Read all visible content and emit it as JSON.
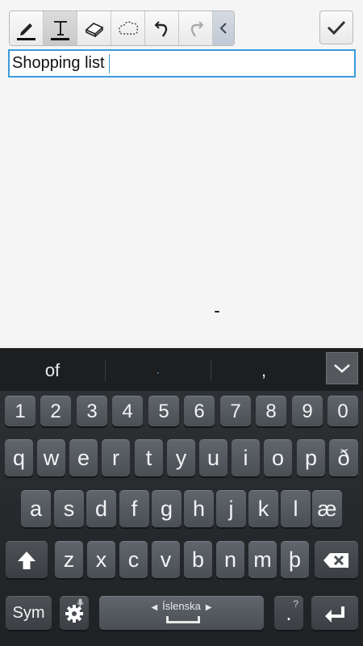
{
  "toolbar": {
    "tools": [
      "pen-icon",
      "text-icon",
      "eraser-icon",
      "lasso-select-icon",
      "undo-icon",
      "redo-icon",
      "chevron-left-icon"
    ],
    "active_tool": "text-icon",
    "done_icon": "checkmark-icon"
  },
  "note": {
    "title_value": "Shopping list"
  },
  "suggestions": [
    "of",
    ".",
    ","
  ],
  "keyboard": {
    "row_digits": [
      "1",
      "2",
      "3",
      "4",
      "5",
      "6",
      "7",
      "8",
      "9",
      "0"
    ],
    "row_1": [
      "q",
      "w",
      "e",
      "r",
      "t",
      "y",
      "u",
      "i",
      "o",
      "p",
      "ð"
    ],
    "row_2": [
      "a",
      "s",
      "d",
      "f",
      "g",
      "h",
      "j",
      "k",
      "l",
      "æ"
    ],
    "row_3": [
      "z",
      "x",
      "c",
      "v",
      "b",
      "n",
      "m",
      "þ"
    ],
    "sym_label": "Sym",
    "language_label": "Íslenska",
    "period_label": ".",
    "period_alt": "?",
    "shift_icon": "shift-arrow-icon",
    "backspace_icon": "backspace-icon",
    "enter_icon": "enter-icon",
    "settings_icon": "gear-icon",
    "mic_icon": "microphone-icon"
  },
  "colors": {
    "accent": "#3a9bdc",
    "keyboard_bg": "#24282b",
    "key_bg": "#575c61",
    "suggestion_bg": "#1d1e20"
  }
}
